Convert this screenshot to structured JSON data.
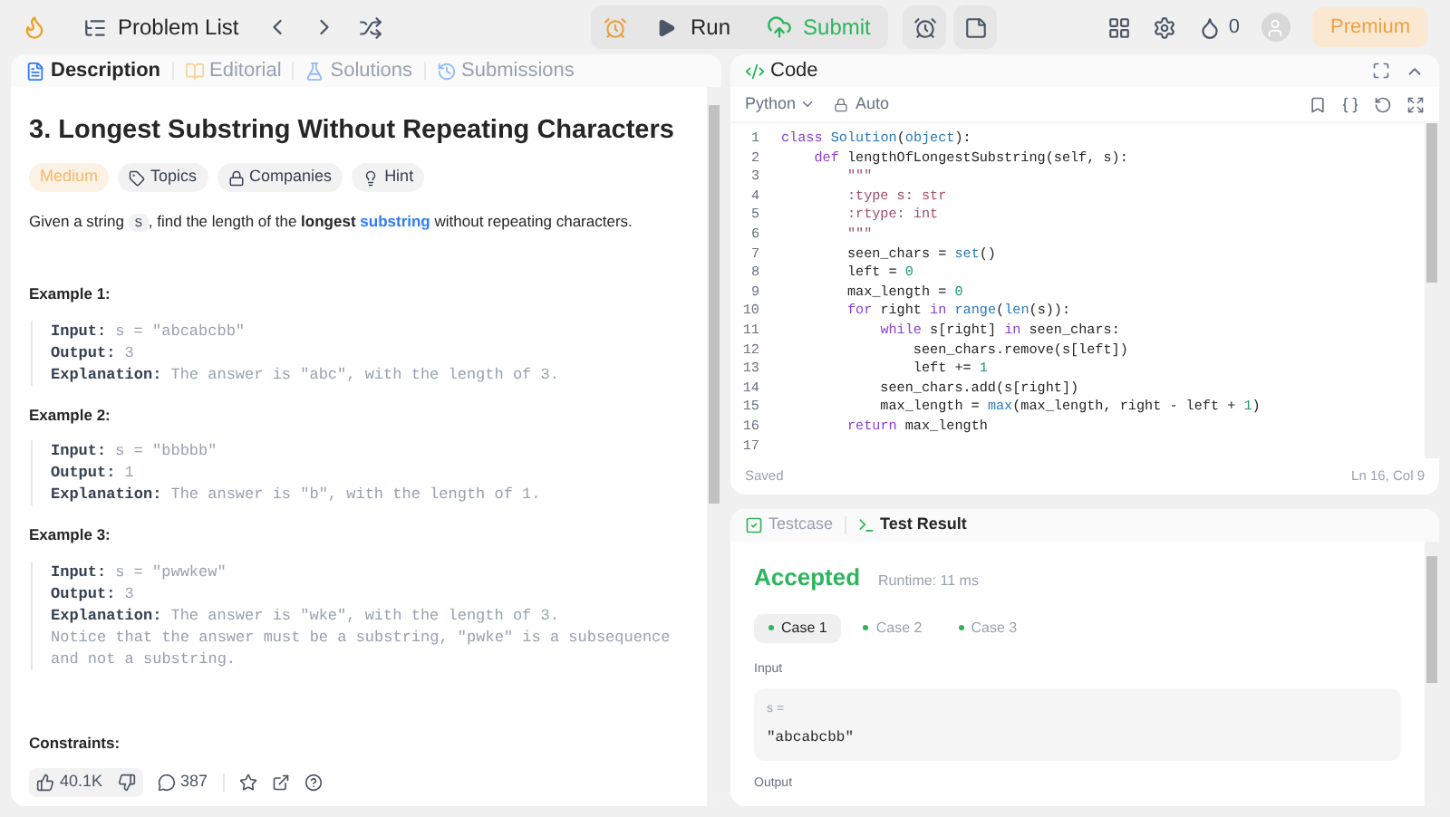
{
  "topbar": {
    "problem_list": "Problem List",
    "run": "Run",
    "submit": "Submit",
    "streak": "0",
    "premium": "Premium"
  },
  "description_tabs": [
    {
      "label": "Description",
      "selected": true,
      "kind": "doc"
    },
    {
      "label": "Editorial",
      "selected": false,
      "kind": "book"
    },
    {
      "label": "Solutions",
      "selected": false,
      "kind": "flask"
    },
    {
      "label": "Submissions",
      "selected": false,
      "kind": "history"
    }
  ],
  "problem": {
    "title": "3. Longest Substring Without Repeating Characters",
    "tags": [
      {
        "label": "Medium",
        "kind": "difficulty"
      },
      {
        "label": "Topics",
        "kind": "tag"
      },
      {
        "label": "Companies",
        "kind": "lock"
      },
      {
        "label": "Hint",
        "kind": "bulb"
      }
    ],
    "statement": [
      {
        "kind": "text",
        "text": "Given a string "
      },
      {
        "kind": "code",
        "text": "s"
      },
      {
        "kind": "text",
        "text": ", find the length of the "
      },
      {
        "kind": "bold",
        "text": "longest"
      },
      {
        "kind": "link",
        "text": "substring"
      },
      {
        "kind": "text",
        "text": " without repeating characters."
      }
    ],
    "examples": [
      {
        "heading": "Example 1:",
        "lines": [
          {
            "label": "Input:",
            "value": "s = \"abcabcbb\""
          },
          {
            "label": "Output:",
            "value": "3"
          },
          {
            "label": "Explanation:",
            "value": "The answer is \"abc\", with the length of 3."
          }
        ]
      },
      {
        "heading": "Example 2:",
        "lines": [
          {
            "label": "Input:",
            "value": "s = \"bbbbb\""
          },
          {
            "label": "Output:",
            "value": "1"
          },
          {
            "label": "Explanation:",
            "value": "The answer is \"b\", with the length of 1."
          }
        ]
      },
      {
        "heading": "Example 3:",
        "lines": [
          {
            "label": "Input:",
            "value": "s = \"pwwkew\""
          },
          {
            "label": "Output:",
            "value": "3"
          },
          {
            "label": "Explanation:",
            "value": "The answer is \"wke\", with the length of 3."
          }
        ],
        "note": "Notice that the answer must be a substring, \"pwke\" is a subsequence and not a substring."
      }
    ],
    "constraints_heading": "Constraints:",
    "likes": "40.1K",
    "comments": "387"
  },
  "code_panel": {
    "title": "Code",
    "language": "Python",
    "mode": "Auto",
    "status": "Saved",
    "cursor": "Ln 16, Col 9",
    "lines": [
      {
        "number": "1",
        "kind": "code",
        "text": "class Solution(object):"
      },
      {
        "number": "2",
        "kind": "code",
        "text": "    def lengthOfLongestSubstring(self, s):"
      },
      {
        "number": "3",
        "kind": "doc",
        "text": "        \"\"\""
      },
      {
        "number": "4",
        "kind": "doc",
        "text": "        :type s: str"
      },
      {
        "number": "5",
        "kind": "doc",
        "text": "        :rtype: int"
      },
      {
        "number": "6",
        "kind": "doc",
        "text": "        \"\"\""
      },
      {
        "number": "7",
        "kind": "code",
        "text": "        seen_chars = set()"
      },
      {
        "number": "8",
        "kind": "code",
        "text": "        left = 0"
      },
      {
        "number": "9",
        "kind": "code",
        "text": "        max_length = 0"
      },
      {
        "number": "10",
        "kind": "code",
        "text": "        for right in range(len(s)):"
      },
      {
        "number": "11",
        "kind": "code",
        "text": "            while s[right] in seen_chars:"
      },
      {
        "number": "12",
        "kind": "code",
        "text": "                seen_chars.remove(s[left])"
      },
      {
        "number": "13",
        "kind": "code",
        "text": "                left += 1"
      },
      {
        "number": "14",
        "kind": "code",
        "text": "            seen_chars.add(s[right])"
      },
      {
        "number": "15",
        "kind": "code",
        "text": "            max_length = max(max_length, right - left + 1)"
      },
      {
        "number": "16",
        "kind": "code",
        "text": "        return max_length"
      },
      {
        "number": "17",
        "kind": "code"
      }
    ]
  },
  "result_panel": {
    "tabs": [
      {
        "label": "Testcase",
        "selected": false
      },
      {
        "label": "Test Result",
        "selected": true
      }
    ],
    "verdict": "Accepted",
    "runtime": "Runtime: 11 ms",
    "cases": [
      {
        "label": "Case 1",
        "selected": true
      },
      {
        "label": "Case 2",
        "selected": false
      },
      {
        "label": "Case 3",
        "selected": false
      }
    ],
    "input_heading": "Input",
    "input_name": "s =",
    "input_value": "\"abcabcbb\"",
    "output_heading": "Output"
  }
}
